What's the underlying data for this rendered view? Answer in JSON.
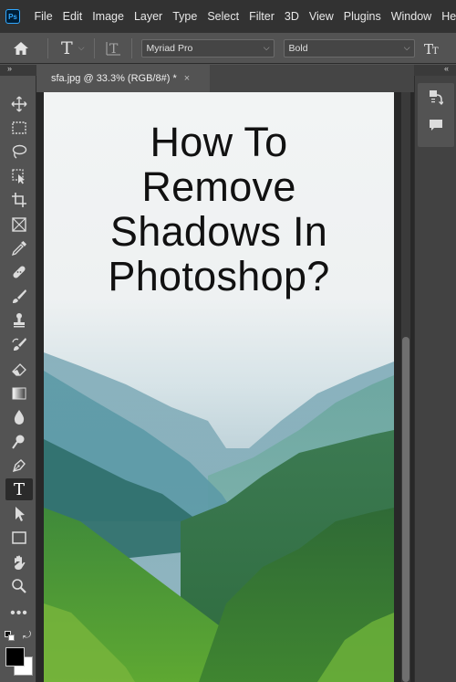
{
  "menubar": {
    "logo": "Ps",
    "items": [
      "File",
      "Edit",
      "Image",
      "Layer",
      "Type",
      "Select",
      "Filter",
      "3D",
      "View",
      "Plugins",
      "Window",
      "He"
    ]
  },
  "options_bar": {
    "tool_letter": "T",
    "font_family": "Myriad Pro",
    "font_style": "Bold"
  },
  "panels": {
    "collapse_left": "»",
    "collapse_right": "«"
  },
  "document": {
    "tab_title": "sfa.jpg @ 33.3% (RGB/8#) *",
    "close": "×",
    "image_title_lines": [
      "How To",
      "Remove",
      "Shadows In",
      "Photoshop?"
    ]
  },
  "toolbar": {
    "tools": [
      "move-tool",
      "marquee-tool",
      "lasso-tool",
      "object-select-tool",
      "crop-tool",
      "frame-tool",
      "eyedropper-tool",
      "healing-brush-tool",
      "brush-tool",
      "clone-stamp-tool",
      "history-brush-tool",
      "eraser-tool",
      "gradient-tool",
      "blur-tool",
      "dodge-tool",
      "pen-tool",
      "type-tool",
      "path-select-tool",
      "rectangle-tool",
      "hand-tool",
      "zoom-tool",
      "more-tools"
    ],
    "active_tool": "type-tool",
    "foreground_color": "#000000",
    "background_color": "#ffffff"
  },
  "colors": {
    "app_bg": "#535353",
    "menubar_bg": "#323232",
    "canvas_bg": "#282828"
  }
}
